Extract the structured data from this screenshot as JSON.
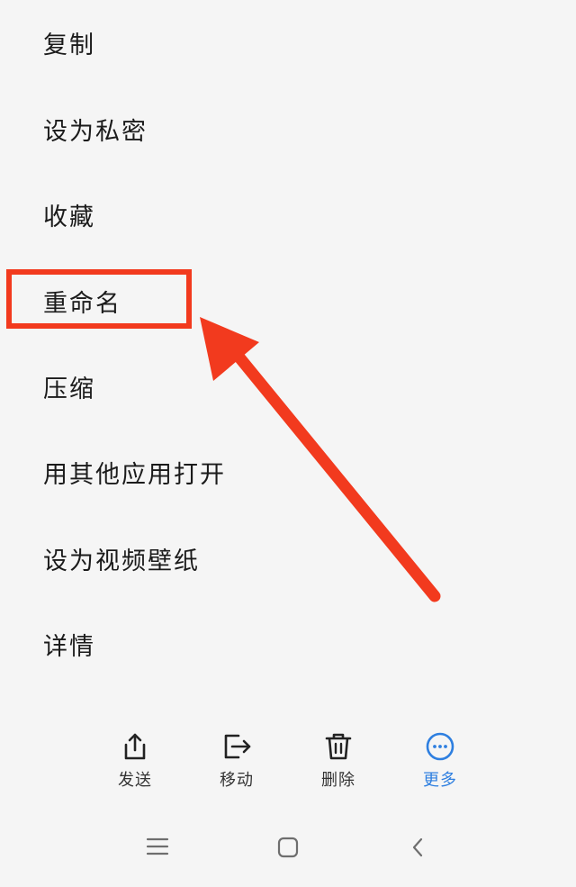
{
  "menu": {
    "items": [
      {
        "label": "复制"
      },
      {
        "label": "设为私密"
      },
      {
        "label": "收藏"
      },
      {
        "label": "重命名"
      },
      {
        "label": "压缩"
      },
      {
        "label": "用其他应用打开"
      },
      {
        "label": "设为视频壁纸"
      },
      {
        "label": "详情"
      }
    ]
  },
  "toolbar": {
    "send_label": "发送",
    "move_label": "移动",
    "delete_label": "删除",
    "more_label": "更多"
  },
  "colors": {
    "annotation": "#f23a1e",
    "accent": "#2e7fe0"
  },
  "icons": {
    "send": "share-icon",
    "move": "move-icon",
    "delete": "trash-icon",
    "more": "more-icon",
    "nav_menu": "menu-lines-icon",
    "nav_home": "home-square-icon",
    "nav_back": "back-chevron-icon"
  }
}
